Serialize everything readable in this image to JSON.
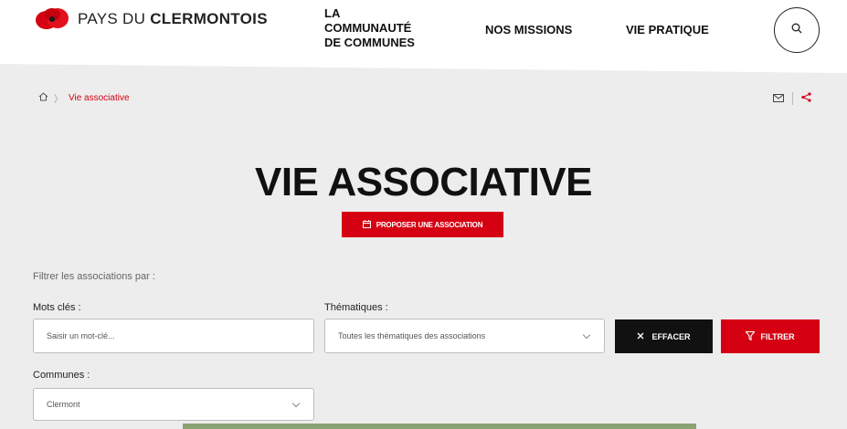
{
  "brand": {
    "name_light": "PAYS DU ",
    "name_bold": "CLERMONTOIS",
    "logo_icon": "poppy-flower-icon",
    "accent_color": "#d50012"
  },
  "nav": {
    "community": "LA\nCOMMUNAUTÉ\nDE COMMUNES",
    "missions": "NOS MISSIONS",
    "pratique": "VIE PRATIQUE",
    "search_icon": "search-icon"
  },
  "breadcrumb": {
    "home_icon": "home-icon",
    "separator": "〉",
    "current": "Vie associative"
  },
  "share": {
    "mail_icon": "mail-icon",
    "share_icon": "share-icon"
  },
  "page": {
    "title": "VIE ASSOCIATIVE",
    "propose_label": "PROPOSER UNE ASSOCIATION",
    "propose_icon": "calendar-icon"
  },
  "filters": {
    "intro": "Filtrer les associations par :",
    "keywords": {
      "label": "Mots clés :",
      "placeholder": "Saisir un mot-clé..."
    },
    "thematiques": {
      "label": "Thématiques :",
      "value": "Toutes les thématiques des associations"
    },
    "communes": {
      "label": "Communes :",
      "value": "Clermont"
    },
    "clear_label": "EFFACER",
    "filter_label": "FILTRER"
  }
}
